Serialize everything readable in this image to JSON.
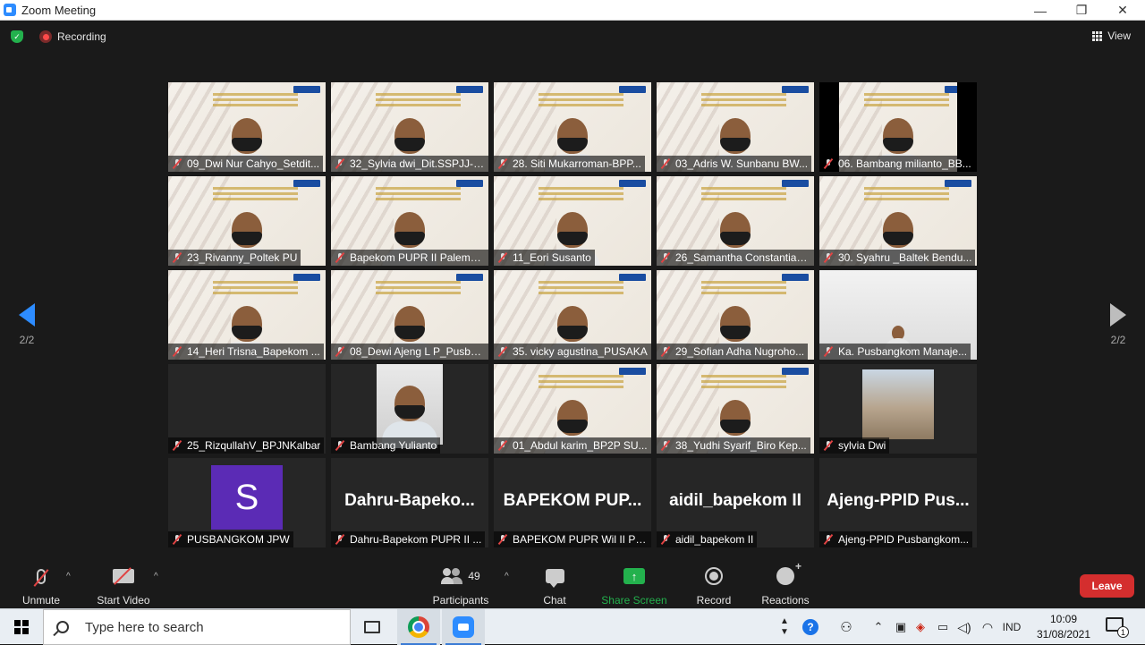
{
  "window": {
    "title": "Zoom Meeting",
    "minimize": "—",
    "restore": "❐",
    "close": "✕"
  },
  "meeting_header": {
    "recording_label": "Recording",
    "view_label": "View"
  },
  "pager": {
    "left_page": "2/2",
    "right_page": "2/2"
  },
  "tiles": [
    {
      "name": "09_Dwi Nur Cahyo_Setdit...",
      "kind": "video"
    },
    {
      "name": "32_Sylvia dwi_Dit.SSPJJ-D...",
      "kind": "video"
    },
    {
      "name": "28. Siti Mukarroman-BPP...",
      "kind": "video"
    },
    {
      "name": "03_Adris W. Sunbanu BW...",
      "kind": "video"
    },
    {
      "name": "06. Bambang milianto_BB...",
      "kind": "video-black-sides"
    },
    {
      "name": "23_Rivanny_Poltek PU",
      "kind": "video"
    },
    {
      "name": "Bapekom PUPR II Palemb...",
      "kind": "video"
    },
    {
      "name": "11_Eori  Susanto",
      "kind": "video"
    },
    {
      "name": "26_Samantha Constantia_...",
      "kind": "video"
    },
    {
      "name": "30. Syahru _Baltek Bendu...",
      "kind": "video"
    },
    {
      "name": "14_Heri Trisna_Bapekom ...",
      "kind": "video"
    },
    {
      "name": "08_Dewi Ajeng L P_Pusba...",
      "kind": "video"
    },
    {
      "name": "35. vicky agustina_PUSAKA",
      "kind": "video"
    },
    {
      "name": "29_Sofian Adha Nugroho...",
      "kind": "video"
    },
    {
      "name": "Ka. Pusbangkom Manaje...",
      "kind": "room"
    },
    {
      "name": "25_RizqullahV_BPJNKalbar",
      "kind": "blank"
    },
    {
      "name": "Bambang Yulianto",
      "kind": "small-video"
    },
    {
      "name": "01_Abdul karim_BP2P SU...",
      "kind": "video"
    },
    {
      "name": "38_Yudhi Syarif_Biro Kep...",
      "kind": "video"
    },
    {
      "name": "sylvia Dwi",
      "kind": "small-photo"
    },
    {
      "name": "PUSBANGKOM JPW",
      "kind": "avatar",
      "initial": "S",
      "avatar_color": "#5b2bb5"
    },
    {
      "name": "Dahru-Bapekom PUPR II ...",
      "kind": "bigname",
      "bigname": "Dahru-Bapeko..."
    },
    {
      "name": "BAPEKOM PUPR Wil II Pal...",
      "kind": "bigname",
      "bigname": "BAPEKOM  PUP..."
    },
    {
      "name": "aidil_bapekom II",
      "kind": "bigname",
      "bigname": "aidil_bapekom II"
    },
    {
      "name": "Ajeng-PPID Pusbangkom...",
      "kind": "bigname",
      "bigname": "Ajeng-PPID  Pus..."
    }
  ],
  "toolbar": {
    "unmute": "Unmute",
    "start_video": "Start Video",
    "participants": "Participants",
    "participants_count": "49",
    "chat": "Chat",
    "share_screen": "Share Screen",
    "record": "Record",
    "reactions": "Reactions",
    "leave": "Leave",
    "caret": "^",
    "share_color": "#23b14d",
    "leave_color": "#d42e2e"
  },
  "taskbar": {
    "search_placeholder": "Type here to search",
    "help": "?",
    "language": "IND",
    "time": "10:09",
    "date": "31/08/2021",
    "notification_count": "1"
  }
}
